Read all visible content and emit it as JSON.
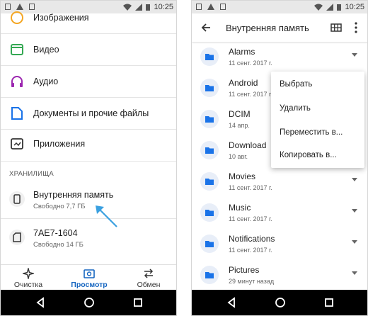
{
  "status": {
    "time": "10:25"
  },
  "left": {
    "categories": [
      {
        "label": "Изображения",
        "icon": "image-icon",
        "color": "#f4a623"
      },
      {
        "label": "Видео",
        "icon": "video-icon",
        "color": "#34a853"
      },
      {
        "label": "Аудио",
        "icon": "headphones-icon",
        "color": "#9c27b0"
      },
      {
        "label": "Документы и прочие файлы",
        "icon": "document-icon",
        "color": "#1a73e8"
      },
      {
        "label": "Приложения",
        "icon": "app-icon",
        "color": "#333333"
      }
    ],
    "storage_section": "ХРАНИЛИЩА",
    "storage": [
      {
        "name": "Внутренняя память",
        "free": "Свободно 7,7 ГБ",
        "icon": "phone-icon"
      },
      {
        "name": "7AE7-1604",
        "free": "Свободно 14 ГБ",
        "icon": "sd-card-icon"
      }
    ],
    "tabs": [
      {
        "label": "Очистка",
        "icon": "sparkle-icon"
      },
      {
        "label": "Просмотр",
        "icon": "browse-icon",
        "active": true
      },
      {
        "label": "Обмен",
        "icon": "swap-icon"
      }
    ]
  },
  "right": {
    "title": "Внутренняя память",
    "folders": [
      {
        "name": "Alarms",
        "date": "11 сент. 2017 г."
      },
      {
        "name": "Android",
        "date": "11 сент. 2017 г."
      },
      {
        "name": "DCIM",
        "date": "14 апр."
      },
      {
        "name": "Download",
        "date": "10 авг."
      },
      {
        "name": "Movies",
        "date": "11 сент. 2017 г."
      },
      {
        "name": "Music",
        "date": "11 сент. 2017 г."
      },
      {
        "name": "Notifications",
        "date": "11 сент. 2017 г."
      },
      {
        "name": "Pictures",
        "date": "29 минут назад"
      }
    ],
    "context_menu": [
      "Выбрать",
      "Удалить",
      "Переместить в...",
      "Копировать в..."
    ]
  },
  "colors": {
    "accent": "#1565c0",
    "folder": "#1a73e8",
    "annotation_arrow": "#3aa0e0"
  }
}
